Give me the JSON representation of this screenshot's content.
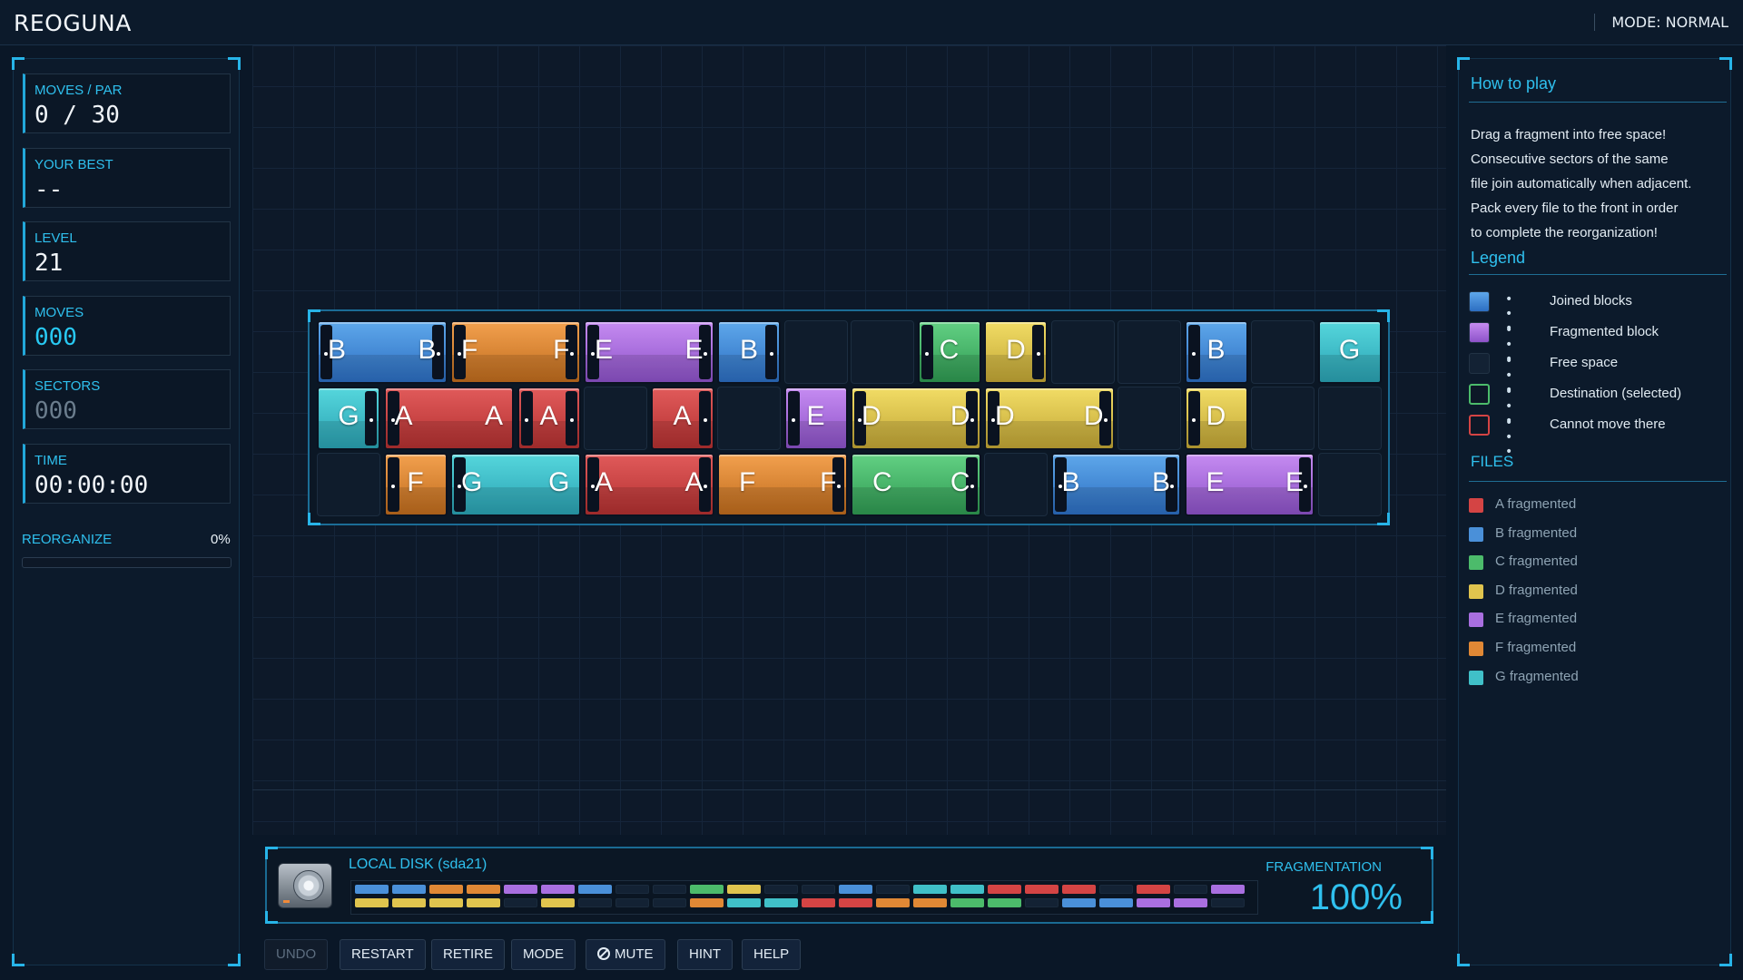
{
  "header": {
    "title": "REOGUNA",
    "mode_label": "MODE: NORMAL"
  },
  "stats": [
    {
      "label": "MOVES / PAR",
      "value": "0 / 30",
      "style": "plain"
    },
    {
      "label": "YOUR BEST",
      "value": "--",
      "style": "plain"
    },
    {
      "label": "LEVEL",
      "value": "21",
      "style": "plain"
    },
    {
      "label": "MOVES",
      "value": "000",
      "style": "cyan"
    },
    {
      "label": "SECTORS",
      "value": "000",
      "style": "dim"
    },
    {
      "label": "TIME",
      "value": "00:00:00",
      "style": "plain"
    }
  ],
  "reorganize": {
    "label": "REORGANIZE",
    "percent_label": "0%",
    "progress": 0
  },
  "colors": {
    "A": "#d44444",
    "B": "#4a90d9",
    "C": "#4cbb6b",
    "D": "#e0c44e",
    "E": "#a96fe0",
    "F": "#e08835",
    "G": "#40c0c8",
    "accent": "#27b4e8",
    "free": "#132234"
  },
  "board": {
    "rows": [
      [
        {
          "type": "frag",
          "file": "B",
          "span": 2,
          "letters": [
            "B",
            "B"
          ],
          "cap": "both"
        },
        {
          "type": "frag",
          "file": "F",
          "span": 2,
          "letters": [
            "F",
            "F"
          ],
          "cap": "both"
        },
        {
          "type": "frag",
          "file": "E",
          "span": 2,
          "letters": [
            "E",
            "E"
          ],
          "cap": "both"
        },
        {
          "type": "frag",
          "file": "B",
          "span": 1,
          "letters": [
            "B"
          ],
          "cap": "right"
        },
        {
          "type": "free",
          "span": 1
        },
        {
          "type": "free",
          "span": 1
        },
        {
          "type": "frag",
          "file": "C",
          "span": 1,
          "letters": [
            "C"
          ],
          "cap": "left"
        },
        {
          "type": "frag",
          "file": "D",
          "span": 1,
          "letters": [
            "D"
          ],
          "cap": "right"
        },
        {
          "type": "free",
          "span": 1
        },
        {
          "type": "free",
          "span": 1
        },
        {
          "type": "frag",
          "file": "B",
          "span": 1,
          "letters": [
            "B"
          ],
          "cap": "left"
        },
        {
          "type": "free",
          "span": 1
        },
        {
          "type": "frag",
          "file": "G",
          "span": 1,
          "letters": [
            "G"
          ],
          "cap": "none"
        }
      ],
      [
        {
          "type": "frag",
          "file": "G",
          "span": 1,
          "letters": [
            "G"
          ],
          "cap": "right"
        },
        {
          "type": "frag",
          "file": "A",
          "span": 2,
          "letters": [
            "A",
            "A"
          ],
          "cap": "left"
        },
        {
          "type": "frag",
          "file": "A",
          "span": 1,
          "letters": [
            "A"
          ],
          "cap": "both"
        },
        {
          "type": "free",
          "span": 1
        },
        {
          "type": "frag",
          "file": "A",
          "span": 1,
          "letters": [
            "A"
          ],
          "cap": "right"
        },
        {
          "type": "free",
          "span": 1
        },
        {
          "type": "frag",
          "file": "E",
          "span": 1,
          "letters": [
            "E"
          ],
          "cap": "left"
        },
        {
          "type": "frag",
          "file": "D",
          "span": 2,
          "letters": [
            "D",
            "D"
          ],
          "cap": "both"
        },
        {
          "type": "frag",
          "file": "D",
          "span": 2,
          "letters": [
            "D",
            "D"
          ],
          "cap": "both"
        },
        {
          "type": "free",
          "span": 1
        },
        {
          "type": "frag",
          "file": "D",
          "span": 1,
          "letters": [
            "D"
          ],
          "cap": "left"
        },
        {
          "type": "free",
          "span": 1
        },
        {
          "type": "free",
          "span": 1
        }
      ],
      [
        {
          "type": "free",
          "span": 1
        },
        {
          "type": "frag",
          "file": "F",
          "span": 1,
          "letters": [
            "F"
          ],
          "cap": "left"
        },
        {
          "type": "frag",
          "file": "G",
          "span": 2,
          "letters": [
            "G",
            "G"
          ],
          "cap": "left"
        },
        {
          "type": "frag",
          "file": "A",
          "span": 2,
          "letters": [
            "A",
            "A"
          ],
          "cap": "both"
        },
        {
          "type": "frag",
          "file": "F",
          "span": 2,
          "letters": [
            "F",
            "F"
          ],
          "cap": "right"
        },
        {
          "type": "frag",
          "file": "C",
          "span": 2,
          "letters": [
            "C",
            "C"
          ],
          "cap": "right"
        },
        {
          "type": "free",
          "span": 1
        },
        {
          "type": "frag",
          "file": "B",
          "span": 2,
          "letters": [
            "B",
            "B"
          ],
          "cap": "both"
        },
        {
          "type": "frag",
          "file": "E",
          "span": 2,
          "letters": [
            "E",
            "E"
          ],
          "cap": "right"
        },
        {
          "type": "free",
          "span": 1
        }
      ]
    ]
  },
  "help": {
    "title": "How to play",
    "lines": [
      "Drag a fragment into free space!",
      "Consecutive sectors of the same",
      "file join automatically when adjacent.",
      "Pack every file to the front in order",
      "to complete the reorganization!"
    ],
    "legend_title": "Legend",
    "legend": [
      {
        "label": "Joined blocks",
        "dots": "• • •",
        "swatch": "joined"
      },
      {
        "label": "Fragmented block",
        "dots": "• • •",
        "swatch": "fragmented"
      },
      {
        "label": "Free space",
        "dots": "• • •",
        "swatch": "free"
      },
      {
        "label": "Destination (selected)",
        "dots": "• • •",
        "swatch": "destination"
      },
      {
        "label": "Cannot move there",
        "dots": "• • •",
        "swatch": "blocked"
      }
    ],
    "files_title": "FILES",
    "files": [
      {
        "label": "A  fragmented",
        "color": "#d44444"
      },
      {
        "label": "B  fragmented",
        "color": "#4a90d9"
      },
      {
        "label": "C  fragmented",
        "color": "#4cbb6b"
      },
      {
        "label": "D  fragmented",
        "color": "#e0c44e"
      },
      {
        "label": "E  fragmented",
        "color": "#a96fe0"
      },
      {
        "label": "F  fragmented",
        "color": "#e08835"
      },
      {
        "label": "G  fragmented",
        "color": "#40c0c8"
      }
    ]
  },
  "disk": {
    "name": "LOCAL DISK (sda21)",
    "fragmentation_label": "FRAGMENTATION",
    "fragmentation_value": "100%",
    "map": [
      [
        "B",
        "B",
        "F",
        "F",
        "E",
        "E",
        "B",
        null,
        null,
        "C",
        "D",
        null,
        null,
        "B",
        null,
        "G",
        "G",
        "A",
        "A",
        "A",
        null,
        "A",
        null,
        "E"
      ],
      [
        "D",
        "D",
        "D",
        "D",
        null,
        "D",
        null,
        null,
        null,
        "F",
        "G",
        "G",
        "A",
        "A",
        "F",
        "F",
        "C",
        "C",
        null,
        "B",
        "B",
        "E",
        "E",
        null
      ]
    ]
  },
  "toolbar": [
    {
      "label": "UNDO",
      "enabled": false,
      "icon": null
    },
    {
      "label": "RESTART",
      "enabled": true,
      "icon": null
    },
    {
      "label": "RETIRE",
      "enabled": true,
      "icon": null
    },
    {
      "label": "MODE",
      "enabled": true,
      "icon": null
    },
    {
      "label": "MUTE",
      "enabled": true,
      "icon": "mute-icon"
    },
    {
      "label": "HINT",
      "enabled": true,
      "icon": null
    },
    {
      "label": "HELP",
      "enabled": true,
      "icon": null
    }
  ]
}
